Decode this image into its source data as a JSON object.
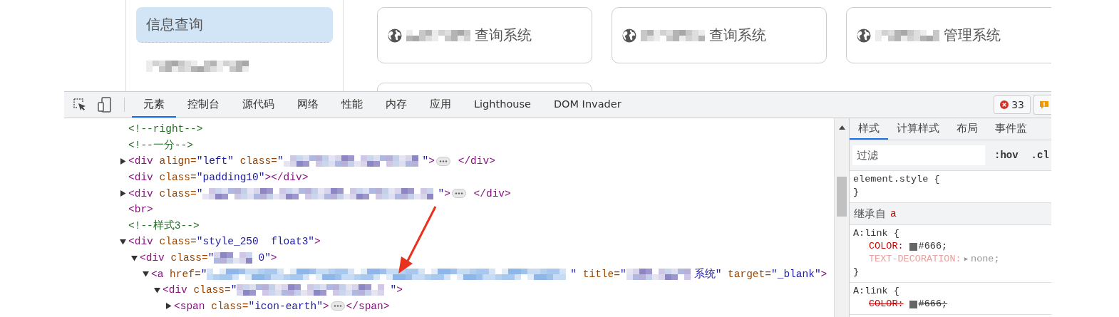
{
  "page": {
    "sidebar": {
      "items": [
        {
          "kind": "text",
          "label": "信息查询",
          "selected": true
        },
        {
          "kind": "redacted",
          "selected": false
        }
      ]
    },
    "cards": [
      {
        "kind": "link",
        "label": "查询系统"
      },
      {
        "kind": "link",
        "label": "查询系统"
      },
      {
        "kind": "link",
        "label": "管理系统"
      },
      {
        "kind": "empty"
      }
    ]
  },
  "devtools": {
    "tabs": [
      {
        "label": "元素",
        "selected": true
      },
      {
        "label": "控制台",
        "selected": false
      },
      {
        "label": "源代码",
        "selected": false
      },
      {
        "label": "网络",
        "selected": false
      },
      {
        "label": "性能",
        "selected": false
      },
      {
        "label": "内存",
        "selected": false
      },
      {
        "label": "应用",
        "selected": false
      },
      {
        "label": "Lighthouse",
        "selected": false
      },
      {
        "label": "DOM Invader",
        "selected": false
      }
    ],
    "errors": "33",
    "dom": [
      {
        "parts": [
          {
            "kind": "comment",
            "text": "<!--right-->"
          }
        ]
      },
      {
        "parts": [
          {
            "kind": "comment",
            "text": "<!--一分-->"
          }
        ]
      },
      {
        "expanded": false,
        "parts": [
          {
            "kind": "tag",
            "text": "<div"
          },
          {
            "kind": "attr",
            "text": " align="
          },
          {
            "kind": "value",
            "text": "\"left\""
          },
          {
            "kind": "attr",
            "text": " class="
          },
          {
            "kind": "value",
            "text": "\""
          },
          {
            "kind": "redacted_medium"
          },
          {
            "kind": "value",
            "text": "\""
          },
          {
            "kind": "tag",
            "text": ">"
          },
          {
            "kind": "ellipsis"
          },
          {
            "kind": "tag",
            "text": " </div>"
          }
        ]
      },
      {
        "parts": [
          {
            "kind": "tag",
            "text": "<div"
          },
          {
            "kind": "attr",
            "text": " class="
          },
          {
            "kind": "value",
            "text": "\"padding10\""
          },
          {
            "kind": "tag",
            "text": "></div>"
          }
        ]
      },
      {
        "expanded": false,
        "parts": [
          {
            "kind": "tag",
            "text": "<div"
          },
          {
            "kind": "attr",
            "text": " class="
          },
          {
            "kind": "value",
            "text": "\""
          },
          {
            "kind": "redacted_huge"
          },
          {
            "kind": "value",
            "text": "\""
          },
          {
            "kind": "tag",
            "text": ">"
          },
          {
            "kind": "ellipsis"
          },
          {
            "kind": "tag",
            "text": " </div>"
          }
        ]
      },
      {
        "parts": [
          {
            "kind": "tag",
            "text": "<br>"
          }
        ]
      },
      {
        "parts": [
          {
            "kind": "comment",
            "text": "<!--样式3-->"
          }
        ]
      },
      {
        "expanded": true,
        "parts": [
          {
            "kind": "tag",
            "text": "<div"
          },
          {
            "kind": "attr",
            "text": " class="
          },
          {
            "kind": "value",
            "text": "\"style_250  float3\""
          },
          {
            "kind": "tag",
            "text": ">"
          }
        ],
        "children": [
          {
            "expanded": true,
            "parts": [
              {
                "kind": "tag",
                "text": "<div"
              },
              {
                "kind": "attr",
                "text": " class="
              },
              {
                "kind": "value",
                "text": "\""
              },
              {
                "kind": "redacted_tiny"
              },
              {
                "kind": "value",
                "text": "0\""
              },
              {
                "kind": "tag",
                "text": ">"
              }
            ],
            "children": [
              {
                "expanded": true,
                "parts": [
                  {
                    "kind": "tag",
                    "text": "<a"
                  },
                  {
                    "kind": "attr",
                    "text": " href="
                  },
                  {
                    "kind": "value",
                    "text": "\""
                  },
                  {
                    "kind": "redacted_giant"
                  },
                  {
                    "kind": "value",
                    "text": "\""
                  },
                  {
                    "kind": "attr",
                    "text": " title="
                  },
                  {
                    "kind": "value",
                    "text": "\""
                  },
                  {
                    "kind": "redacted_short"
                  },
                  {
                    "kind": "value",
                    "text": "系统\""
                  },
                  {
                    "kind": "attr",
                    "text": " target="
                  },
                  {
                    "kind": "value",
                    "text": "\"_blank\""
                  },
                  {
                    "kind": "tag",
                    "text": ">"
                  }
                ],
                "children": [
                  {
                    "expanded": true,
                    "parts": [
                      {
                        "kind": "tag",
                        "text": "<div"
                      },
                      {
                        "kind": "attr",
                        "text": " class="
                      },
                      {
                        "kind": "value",
                        "text": "\""
                      },
                      {
                        "kind": "redacted_long"
                      },
                      {
                        "kind": "value",
                        "text": "\""
                      },
                      {
                        "kind": "tag",
                        "text": ">"
                      }
                    ],
                    "children": [
                      {
                        "expanded": false,
                        "parts": [
                          {
                            "kind": "tag",
                            "text": "<span"
                          },
                          {
                            "kind": "attr",
                            "text": " class="
                          },
                          {
                            "kind": "value",
                            "text": "\"icon-earth\""
                          },
                          {
                            "kind": "tag",
                            "text": ">"
                          },
                          {
                            "kind": "ellipsis"
                          },
                          {
                            "kind": "tag",
                            "text": "</span>"
                          }
                        ]
                      }
                    ]
                  }
                ]
              }
            ]
          }
        ]
      }
    ],
    "styles": {
      "tabs": [
        {
          "label": "样式",
          "selected": true
        },
        {
          "label": "计算样式",
          "selected": false
        },
        {
          "label": "布局",
          "selected": false
        },
        {
          "label": "事件监",
          "selected": false
        }
      ],
      "filter": {
        "placeholder": "过滤"
      },
      "buttons": [
        ":hov",
        ".cl"
      ],
      "blocks": [
        {
          "kind": "rule",
          "selector": "element.style {",
          "close": "}"
        },
        {
          "kind": "header",
          "label": "继承自",
          "tag": "a"
        },
        {
          "kind": "rule",
          "selector": "A:link {",
          "declarations": [
            {
              "property": "COLOR:",
              "color": "#666666",
              "value": "#666;",
              "faded": false,
              "overridden": false
            },
            {
              "property": "TEXT-DECORATION:",
              "expander": "▶",
              "value": "none;",
              "faded": true,
              "overridden": false
            }
          ],
          "close": "}"
        },
        {
          "kind": "rule",
          "selector": "A:link {",
          "declarations": [
            {
              "property": "COLOR:",
              "color": "#666666",
              "value": "#666;",
              "faded": false,
              "overridden": true
            }
          ]
        }
      ]
    }
  },
  "annotations": [
    {
      "kind": "arrow"
    }
  ]
}
